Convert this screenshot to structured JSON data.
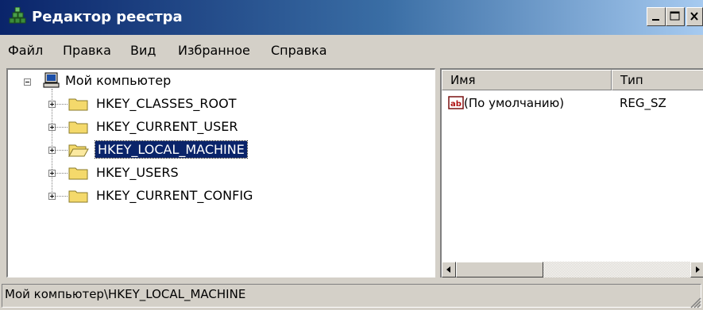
{
  "window": {
    "title": "Редактор реестра"
  },
  "menu": [
    "Файл",
    "Правка",
    "Вид",
    "Избранное",
    "Справка"
  ],
  "tree": {
    "root": "Мой компьютер",
    "children": [
      "HKEY_CLASSES_ROOT",
      "HKEY_CURRENT_USER",
      "HKEY_LOCAL_MACHINE",
      "HKEY_USERS",
      "HKEY_CURRENT_CONFIG"
    ],
    "selected": "HKEY_LOCAL_MACHINE"
  },
  "list": {
    "columns": [
      "Имя",
      "Тип"
    ],
    "rows": [
      {
        "name": "(По умолчанию)",
        "type": "REG_SZ"
      }
    ]
  },
  "status": "Мой компьютер\\HKEY_LOCAL_MACHINE",
  "colors": {
    "titlebar_start": "#0a246a",
    "titlebar_end": "#a6caf0",
    "selection": "#0a246a",
    "folder": "#f4d96b"
  }
}
